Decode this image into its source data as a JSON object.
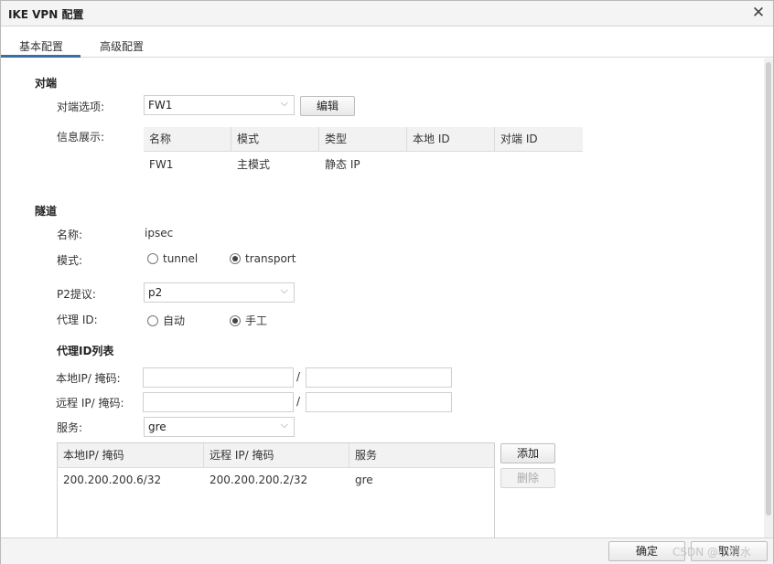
{
  "window": {
    "title": "IKE VPN 配置",
    "close_label": "✕"
  },
  "tabs": [
    {
      "label": "基本配置",
      "active": true
    },
    {
      "label": "高级配置",
      "active": false
    }
  ],
  "peer": {
    "section_title": "对端",
    "option_label": "对端选项:",
    "option_value": "FW1",
    "edit_label": "编辑",
    "info_label": "信息展示:",
    "info_columns": [
      "名称",
      "模式",
      "类型",
      "本地 ID",
      "对端 ID"
    ],
    "info_rows": [
      [
        "FW1",
        "主模式",
        "静态 IP",
        "",
        ""
      ]
    ]
  },
  "tunnel": {
    "section_title": "隧道",
    "name_label": "名称:",
    "name_value": "ipsec",
    "mode_label": "模式:",
    "mode_options": [
      "tunnel",
      "transport"
    ],
    "mode_selected": "transport",
    "p2_label": "P2提议:",
    "p2_value": "p2",
    "proxy_id_label": "代理 ID:",
    "proxy_id_options": [
      "自动",
      "手工"
    ],
    "proxy_id_selected": "手工"
  },
  "proxy_list": {
    "title": "代理ID列表",
    "local_label": "本地IP/ 掩码:",
    "remote_label": "远程 IP/ 掩码:",
    "separator": "/",
    "local_ip": "",
    "local_mask": "",
    "remote_ip": "",
    "remote_mask": "",
    "service_label": "服务:",
    "service_value": "gre",
    "columns": [
      "本地IP/ 掩码",
      "远程 IP/ 掩码",
      "服务"
    ],
    "rows": [
      [
        "200.200.200.6/32",
        "200.200.200.2/32",
        "gre"
      ]
    ],
    "add_label": "添加",
    "delete_label": "删除"
  },
  "footer": {
    "ok_label": "确定",
    "cancel_label": "取消",
    "watermark": "CSDN @小萌水"
  },
  "colors": {
    "tab_active_underline": "#3a6ea5",
    "header_bg": "#f2f2f2"
  }
}
